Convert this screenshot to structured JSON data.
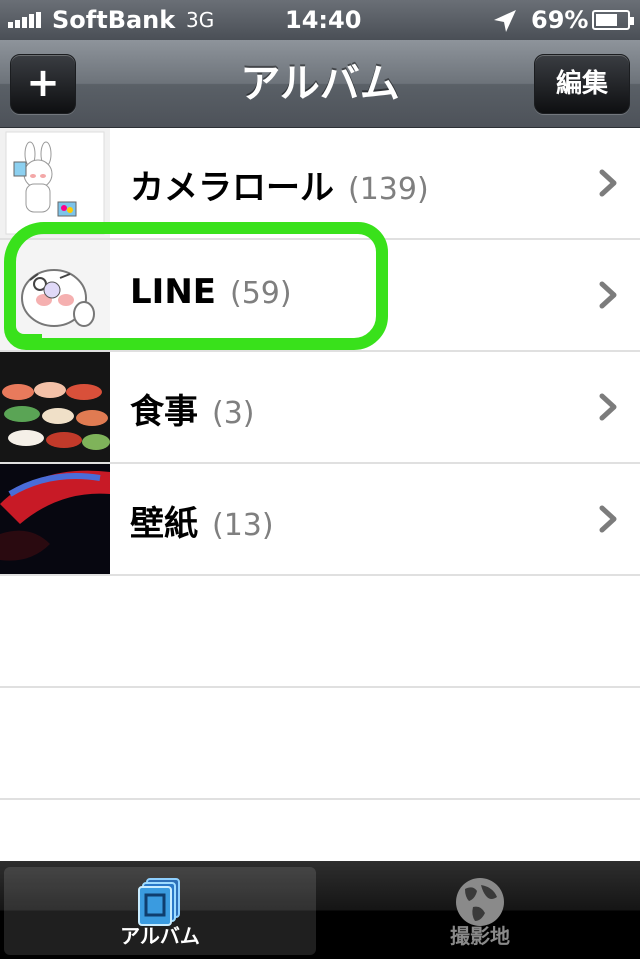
{
  "status_bar": {
    "carrier": "SoftBank",
    "network": "3G",
    "time": "14:40",
    "battery_percent": "69%",
    "battery_level": 0.69
  },
  "nav_bar": {
    "title": "アルバム",
    "add_label": "+",
    "edit_label": "編集"
  },
  "albums": [
    {
      "name": "カメラロール",
      "count": "(139)",
      "thumbnail": "camera-roll-thumbnail"
    },
    {
      "name": "LINE",
      "count": "(59)",
      "thumbnail": "line-sticker-thumbnail"
    },
    {
      "name": "食事",
      "count": "(3)",
      "thumbnail": "sushi-thumbnail"
    },
    {
      "name": "壁紙",
      "count": "(13)",
      "thumbnail": "wallpaper-thumbnail"
    }
  ],
  "tab_bar": {
    "tabs": [
      {
        "label": "アルバム",
        "icon": "albums-icon",
        "active": true
      },
      {
        "label": "撮影地",
        "icon": "globe-icon",
        "active": false
      }
    ]
  },
  "colors": {
    "highlight": "#39e11b",
    "count_text": "#7f7f7f"
  }
}
